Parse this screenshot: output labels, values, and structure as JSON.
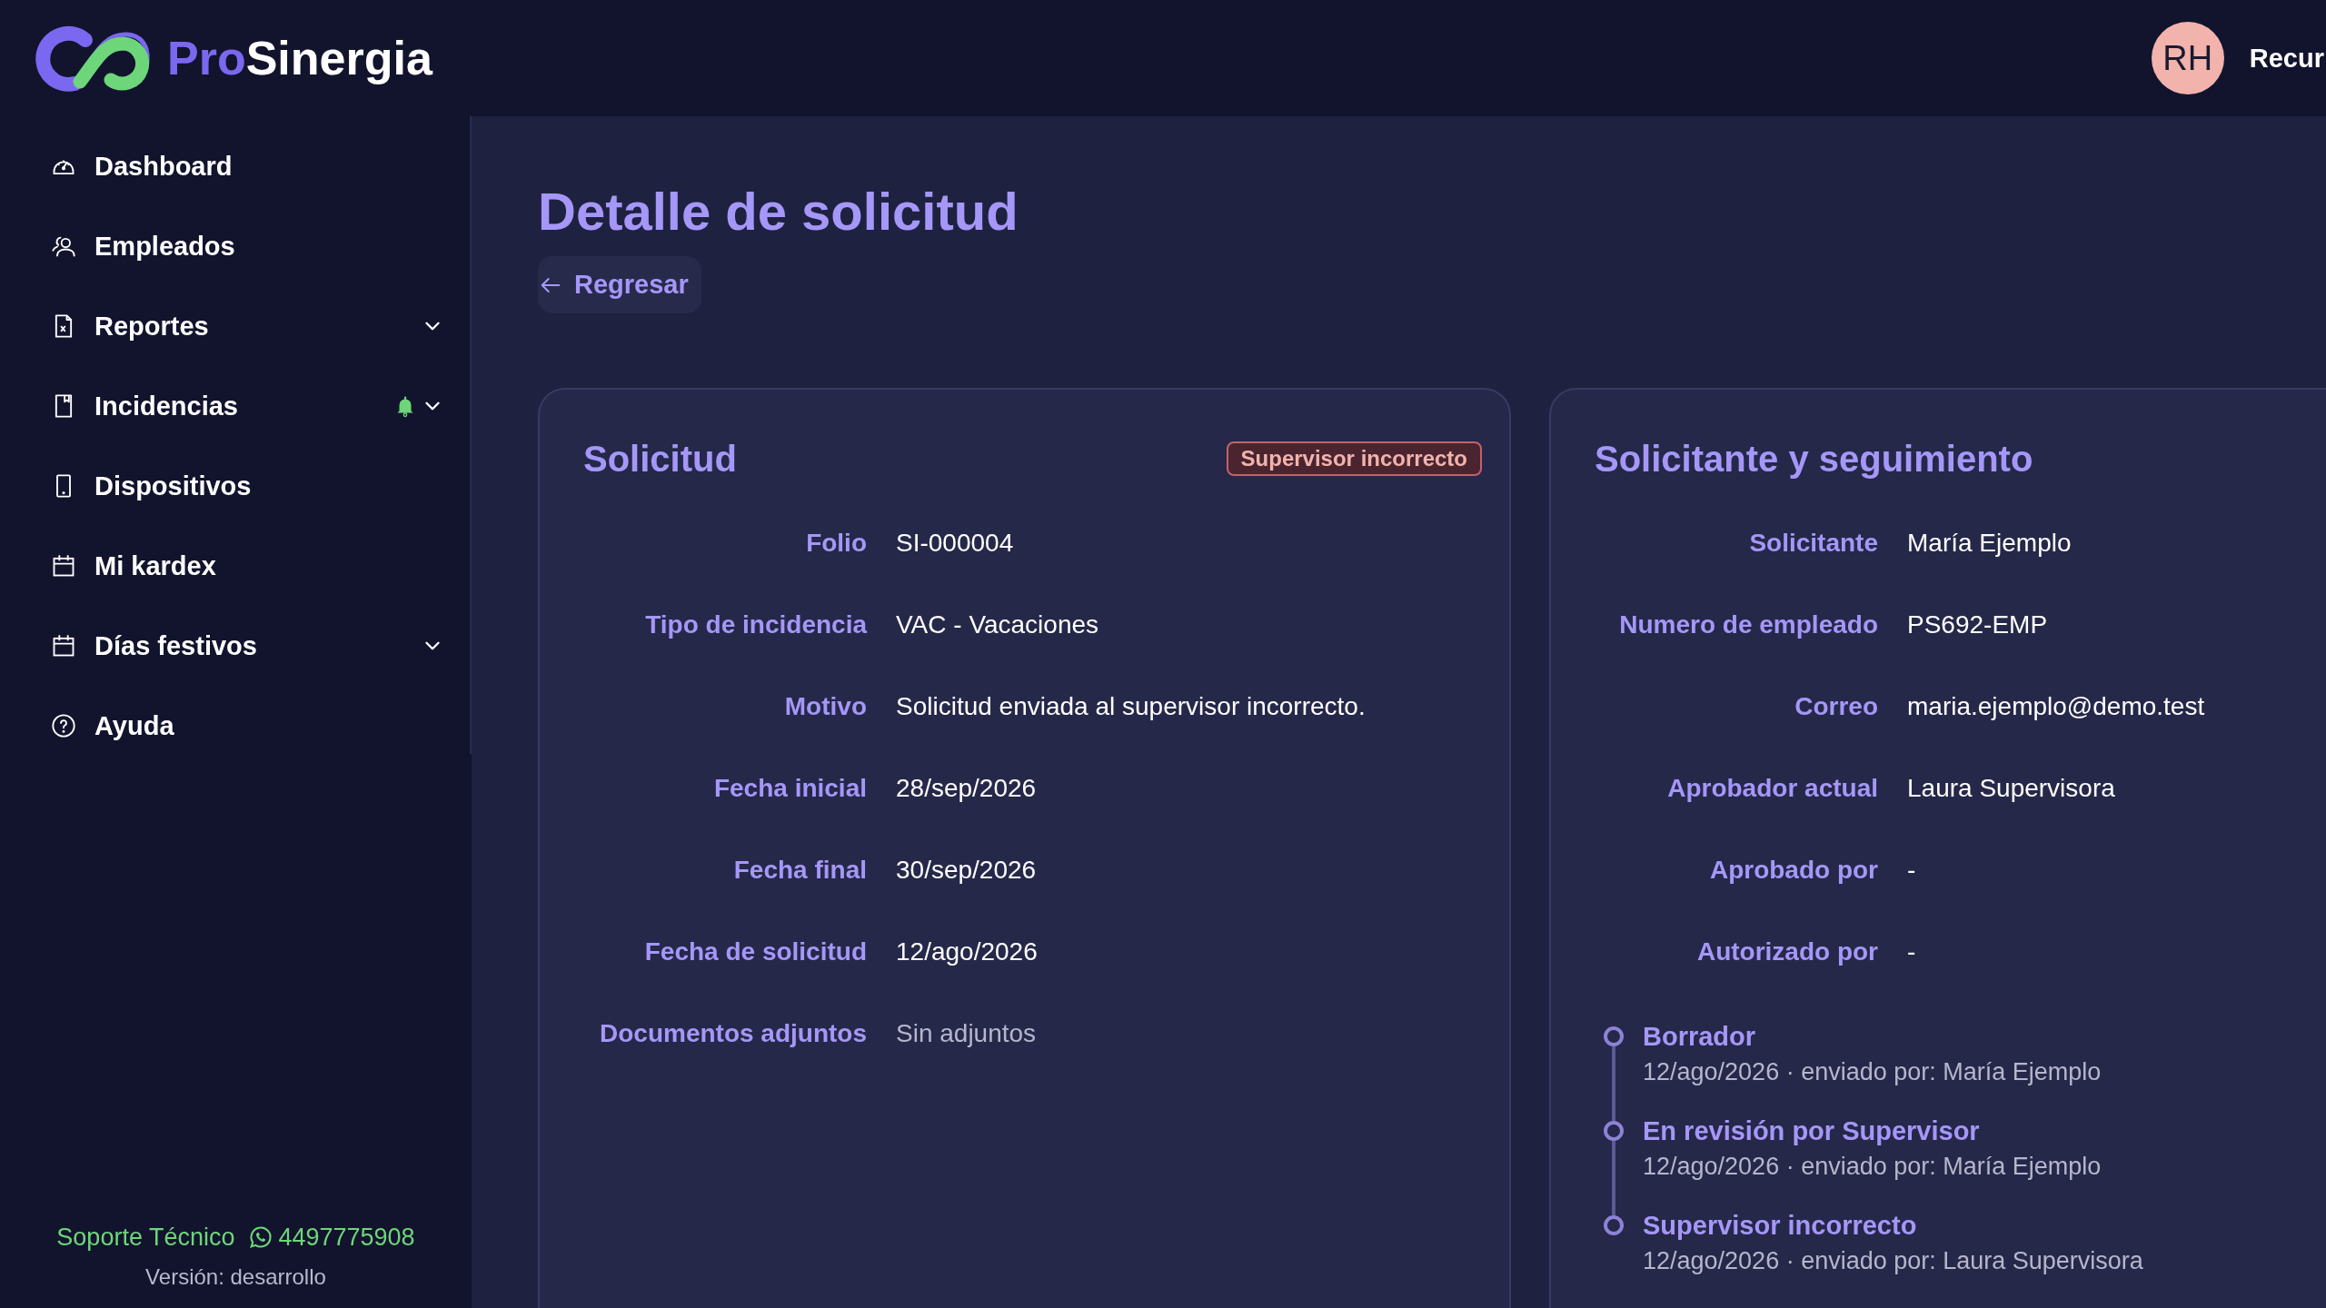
{
  "brand": {
    "prefix": "Pro",
    "name": "Sinergia"
  },
  "user": {
    "initials": "RH",
    "name": "Recur"
  },
  "sidebar": {
    "items": [
      {
        "label": "Dashboard",
        "has_submenu": false,
        "notification": false
      },
      {
        "label": "Empleados",
        "has_submenu": false,
        "notification": false
      },
      {
        "label": "Reportes",
        "has_submenu": true,
        "notification": false
      },
      {
        "label": "Incidencias",
        "has_submenu": true,
        "notification": true
      },
      {
        "label": "Dispositivos",
        "has_submenu": false,
        "notification": false
      },
      {
        "label": "Mi kardex",
        "has_submenu": false,
        "notification": false
      },
      {
        "label": "Días festivos",
        "has_submenu": true,
        "notification": false
      },
      {
        "label": "Ayuda",
        "has_submenu": false,
        "notification": false
      }
    ],
    "support": {
      "label": "Soporte Técnico",
      "phone": "4497775908"
    },
    "version": "Versión: desarrollo"
  },
  "page": {
    "title": "Detalle de solicitud",
    "back_button": "Regresar"
  },
  "request_card": {
    "title": "Solicitud",
    "status_badge": "Supervisor incorrecto",
    "fields": [
      {
        "label": "Folio",
        "value": "SI-000004",
        "muted": false
      },
      {
        "label": "Tipo de incidencia",
        "value": "VAC - Vacaciones",
        "muted": false
      },
      {
        "label": "Motivo",
        "value": "Solicitud enviada al supervisor incorrecto.",
        "muted": false
      },
      {
        "label": "Fecha inicial",
        "value": "28/sep/2026",
        "muted": false
      },
      {
        "label": "Fecha final",
        "value": "30/sep/2026",
        "muted": false
      },
      {
        "label": "Fecha de solicitud",
        "value": "12/ago/2026",
        "muted": false
      },
      {
        "label": "Documentos adjuntos",
        "value": "Sin adjuntos",
        "muted": true
      }
    ]
  },
  "requester_card": {
    "title": "Solicitante y seguimiento",
    "fields": [
      {
        "label": "Solicitante",
        "value": "María Ejemplo",
        "muted": false
      },
      {
        "label": "Numero de empleado",
        "value": "PS692-EMP",
        "muted": false
      },
      {
        "label": "Correo",
        "value": "maria.ejemplo@demo.test",
        "muted": false
      },
      {
        "label": "Aprobador actual",
        "value": "Laura Supervisora",
        "muted": false
      },
      {
        "label": "Aprobado por",
        "value": "-",
        "muted": false
      },
      {
        "label": "Autorizado por",
        "value": "-",
        "muted": false
      }
    ],
    "timeline": [
      {
        "status": "Borrador",
        "detail": "12/ago/2026 · enviado por: María Ejemplo"
      },
      {
        "status": "En revisión por Supervisor",
        "detail": "12/ago/2026 · enviado por: María Ejemplo"
      },
      {
        "status": "Supervisor incorrecto",
        "detail": "12/ago/2026 · enviado por: Laura Supervisora"
      }
    ]
  }
}
